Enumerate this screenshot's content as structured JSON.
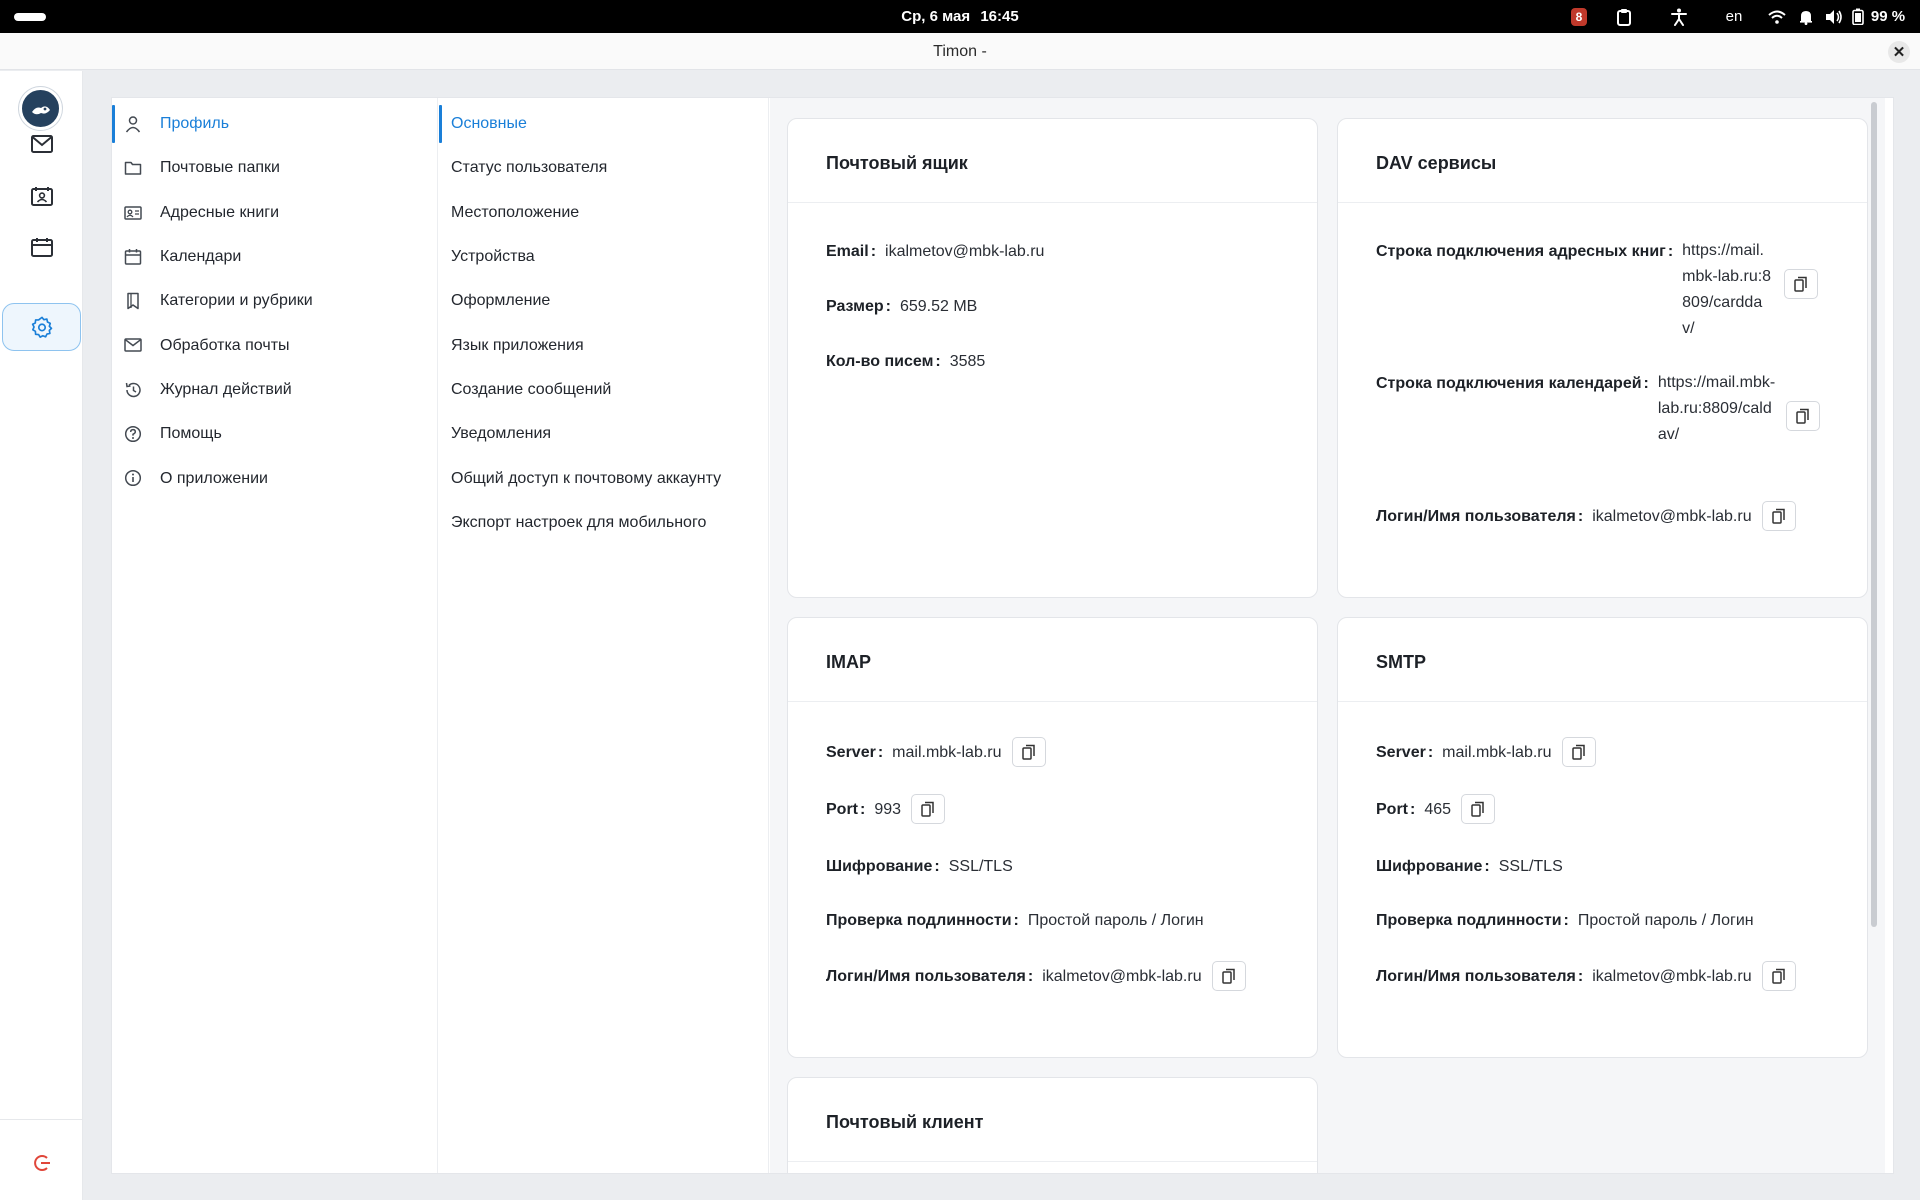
{
  "topbar": {
    "date": "Ср, 6 мая",
    "time": "16:45",
    "notification_count": "8",
    "language": "en",
    "battery": "99 %"
  },
  "window": {
    "title": "Timon -"
  },
  "nav_main": {
    "items": [
      {
        "label": "Профиль",
        "icon": "user-icon",
        "active": true
      },
      {
        "label": "Почтовые папки",
        "icon": "folder-icon"
      },
      {
        "label": "Адресные книги",
        "icon": "contact-card-icon"
      },
      {
        "label": "Календари",
        "icon": "calendar-icon"
      },
      {
        "label": "Категории и рубрики",
        "icon": "bookmark-icon"
      },
      {
        "label": "Обработка почты",
        "icon": "mail-icon"
      },
      {
        "label": "Журнал действий",
        "icon": "history-icon"
      },
      {
        "label": "Помощь",
        "icon": "help-icon"
      },
      {
        "label": "О приложении",
        "icon": "info-icon"
      }
    ]
  },
  "nav_sub": {
    "items": [
      {
        "label": "Основные",
        "active": true
      },
      {
        "label": "Статус пользователя"
      },
      {
        "label": "Местоположение"
      },
      {
        "label": "Устройства"
      },
      {
        "label": "Оформление"
      },
      {
        "label": "Язык приложения"
      },
      {
        "label": "Создание сообщений"
      },
      {
        "label": "Уведомления"
      },
      {
        "label": "Общий доступ к почтовому аккаунту"
      },
      {
        "label": "Экспорт настроек для мобильного"
      }
    ]
  },
  "mailbox": {
    "title": "Почтовый ящик",
    "email_label": "Email",
    "email": "ikalmetov@mbk-lab.ru",
    "size_label": "Размер",
    "size": "659.52 MB",
    "count_label": "Кол-во писем",
    "count": "3585"
  },
  "dav": {
    "title": "DAV сервисы",
    "addressbook_label": "Строка подключения адресных книг",
    "addressbook_url": "https://mail.mbk-lab.ru:8809/carddav/",
    "calendar_label": "Строка подключения календарей",
    "calendar_url": "https://mail.mbk-lab.ru:8809/caldav/",
    "login_label": "Логин/Имя пользователя",
    "login": "ikalmetov@mbk-lab.ru"
  },
  "imap": {
    "title": "IMAP",
    "server_label": "Server",
    "server": "mail.mbk-lab.ru",
    "port_label": "Port",
    "port": "993",
    "enc_label": "Шифрование",
    "enc": "SSL/TLS",
    "auth_label": "Проверка подлинности",
    "auth": "Простой пароль / Логин",
    "login_label": "Логин/Имя пользователя",
    "login": "ikalmetov@mbk-lab.ru"
  },
  "smtp": {
    "title": "SMTP",
    "server_label": "Server",
    "server": "mail.mbk-lab.ru",
    "port_label": "Port",
    "port": "465",
    "enc_label": "Шифрование",
    "enc": "SSL/TLS",
    "auth_label": "Проверка подлинности",
    "auth": "Простой пароль / Логин",
    "login_label": "Логин/Имя пользователя",
    "login": "ikalmetov@mbk-lab.ru"
  },
  "mail_client": {
    "title": "Почтовый клиент"
  },
  "colors": {
    "accent": "#1a7fd8",
    "logout": "#e0463a",
    "badge": "#c0392b"
  }
}
